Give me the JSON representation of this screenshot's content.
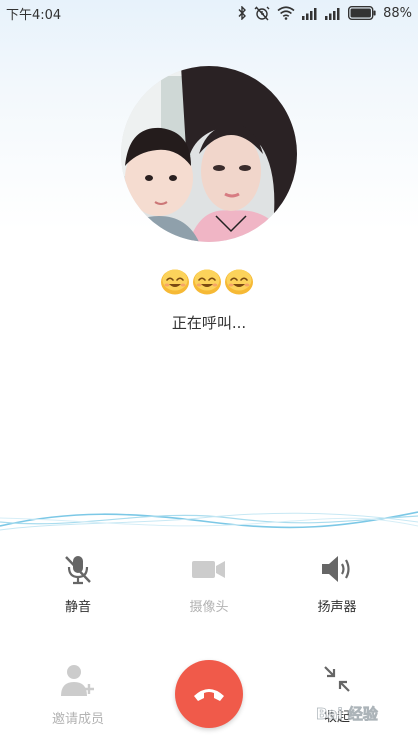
{
  "status_bar": {
    "time": "下午4:04",
    "battery_percent": "88%",
    "battery_level": 0.88,
    "icons": [
      "bluetooth-icon",
      "alarm-off-icon",
      "wifi-icon",
      "signal-icon",
      "signal-icon",
      "battery-icon"
    ]
  },
  "call": {
    "status_text": "正在呼叫...",
    "emoji_count": 3,
    "emoji_name": "smiling-face-emoji"
  },
  "controls": {
    "mute_label": "静音",
    "camera_label": "摄像头",
    "speaker_label": "扬声器",
    "invite_label": "邀请成员",
    "collapse_label": "收起"
  },
  "colors": {
    "hangup": "#f05a4a",
    "active_icon": "#666666",
    "disabled_icon": "#cccccc",
    "wave": "#7cc8e6"
  }
}
